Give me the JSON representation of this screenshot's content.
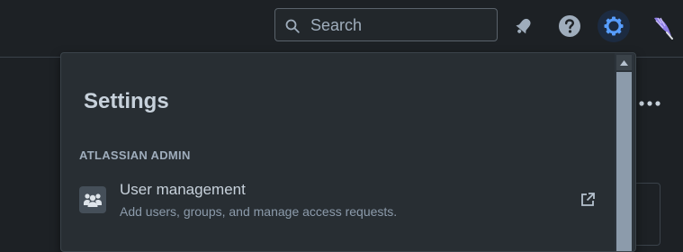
{
  "search": {
    "placeholder": "Search",
    "icon": "search-icon"
  },
  "topbar_icons": [
    "notifications-icon",
    "help-icon",
    "settings-icon",
    "avatar"
  ],
  "colors": {
    "accent": "#579dff",
    "background": "#1d2125",
    "panel": "#282e33"
  },
  "settings_panel": {
    "title": "Settings",
    "section": "ATLASSIAN ADMIN",
    "items": [
      {
        "label": "User management",
        "description": "Add users, groups, and manage access requests.",
        "icon": "people-icon",
        "trailing_icon": "external-link-icon"
      }
    ]
  }
}
